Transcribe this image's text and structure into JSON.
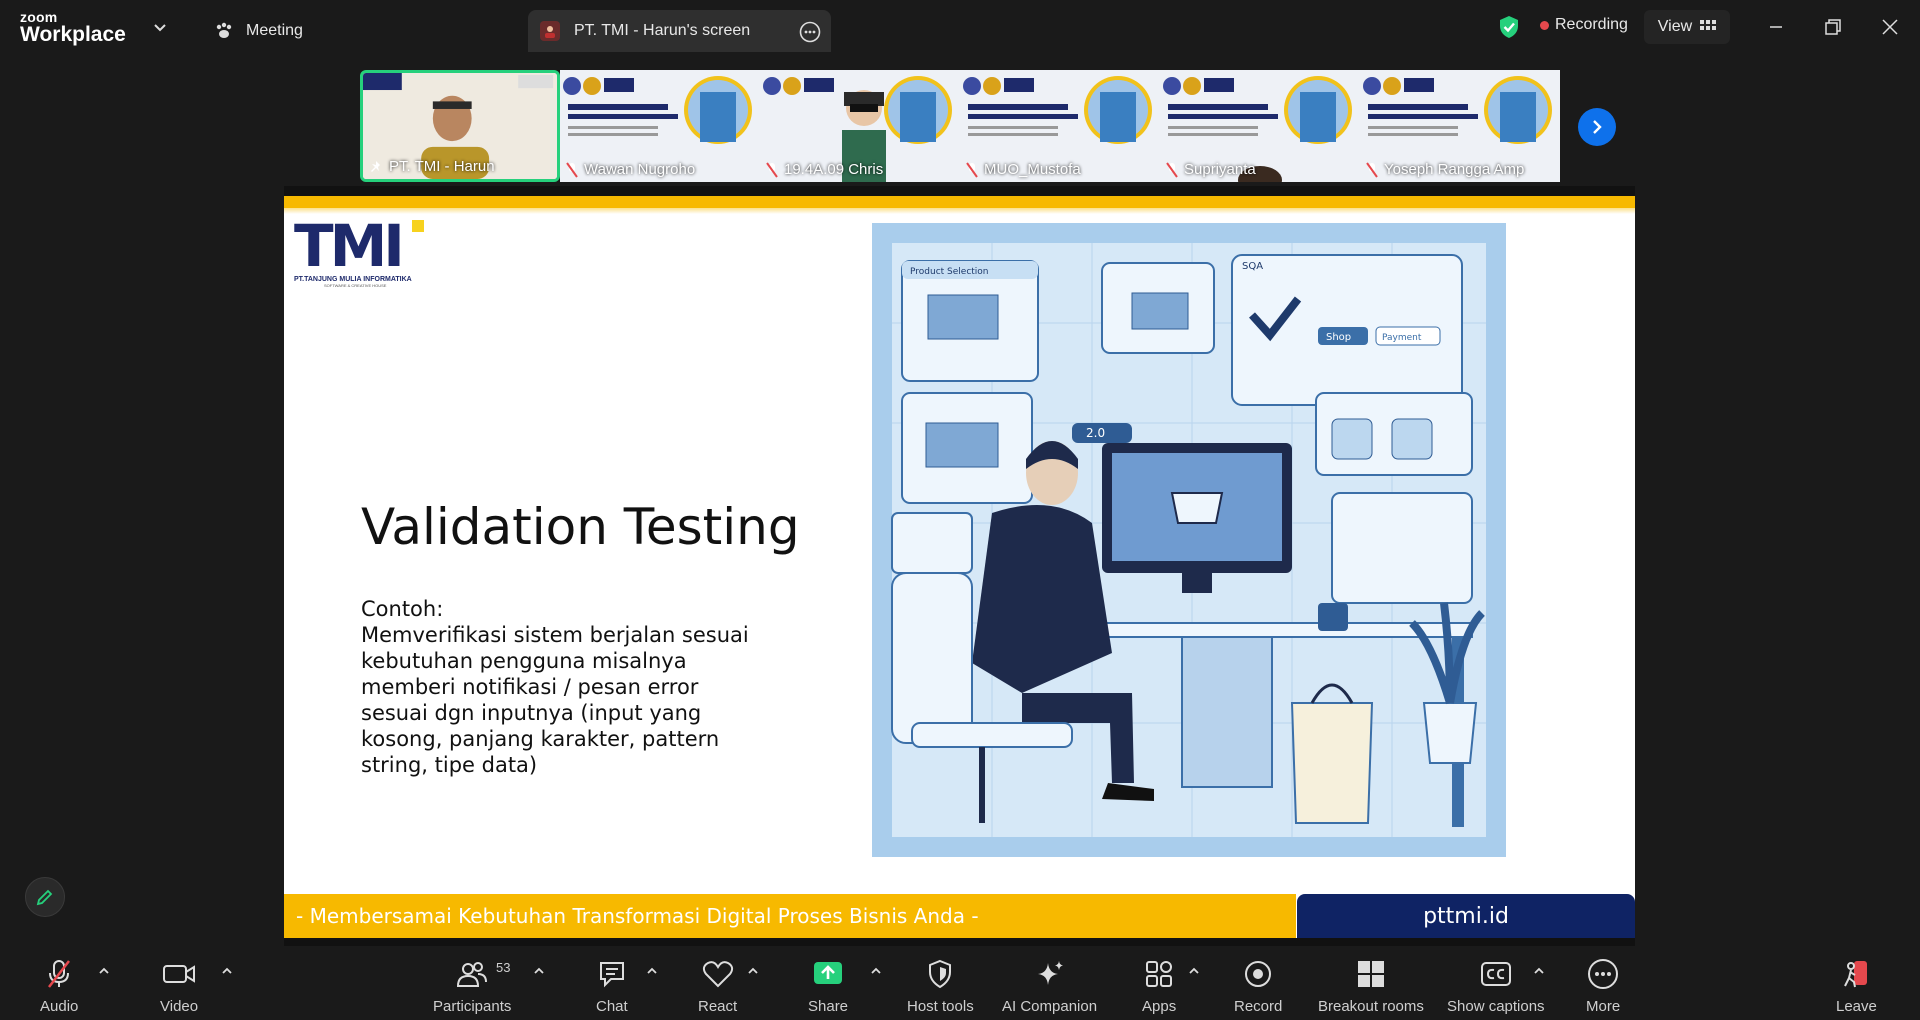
{
  "titlebar": {
    "brand_top": "zoom",
    "brand_bottom": "Workplace",
    "meeting_tab": "Meeting",
    "screen_tab": "PT. TMI - Harun's screen",
    "recording": "Recording",
    "view": "View"
  },
  "thumbnails": [
    {
      "name": "PT. TMI - Harun",
      "active": true,
      "muted": false
    },
    {
      "name": "Wawan Nugroho",
      "active": false,
      "muted": true
    },
    {
      "name": "19.4A.09 Chris",
      "active": false,
      "muted": true
    },
    {
      "name": "MUO_Mustofa",
      "active": false,
      "muted": true
    },
    {
      "name": "Supriyanta",
      "active": false,
      "muted": true
    },
    {
      "name": "Yoseph Rangga Amp",
      "active": false,
      "muted": true
    }
  ],
  "slide": {
    "title": "Validation Testing",
    "body_label": "Contoh:",
    "body_text": "Memverifikasi sistem berjalan sesuai kebutuhan pengguna misalnya memberi notifikasi / pesan error sesuai dgn inputnya (input yang kosong, panjang karakter, pattern string, tipe data)",
    "logo_text": "TMI",
    "logo_company": "PT.TANJUNG MULIA INFORMATIKA",
    "logo_tagline": "SOFTWARE & CREATIVE HOUSE",
    "footer_tagline": "- Membersamai Kebutuhan Transformasi Digital Proses Bisnis Anda -",
    "footer_site": "pttmi.id",
    "illus_labels": {
      "product_selection": "Product Selection",
      "sqa": "SQA",
      "shop": "Shop",
      "payment": "Payment",
      "rating": "2.0"
    }
  },
  "toolbar": {
    "audio": "Audio",
    "video": "Video",
    "participants": "Participants",
    "participant_count": "53",
    "chat": "Chat",
    "react": "React",
    "share": "Share",
    "host_tools": "Host tools",
    "ai_companion": "AI Companion",
    "apps": "Apps",
    "record": "Record",
    "breakout_rooms": "Breakout rooms",
    "show_captions": "Show captions",
    "more": "More",
    "leave": "Leave"
  },
  "colors": {
    "accent_green": "#26d07c",
    "zoom_blue": "#0e71eb",
    "slide_yellow": "#f7b900",
    "slide_navy": "#0f2364",
    "recording_red": "#e5484d"
  }
}
